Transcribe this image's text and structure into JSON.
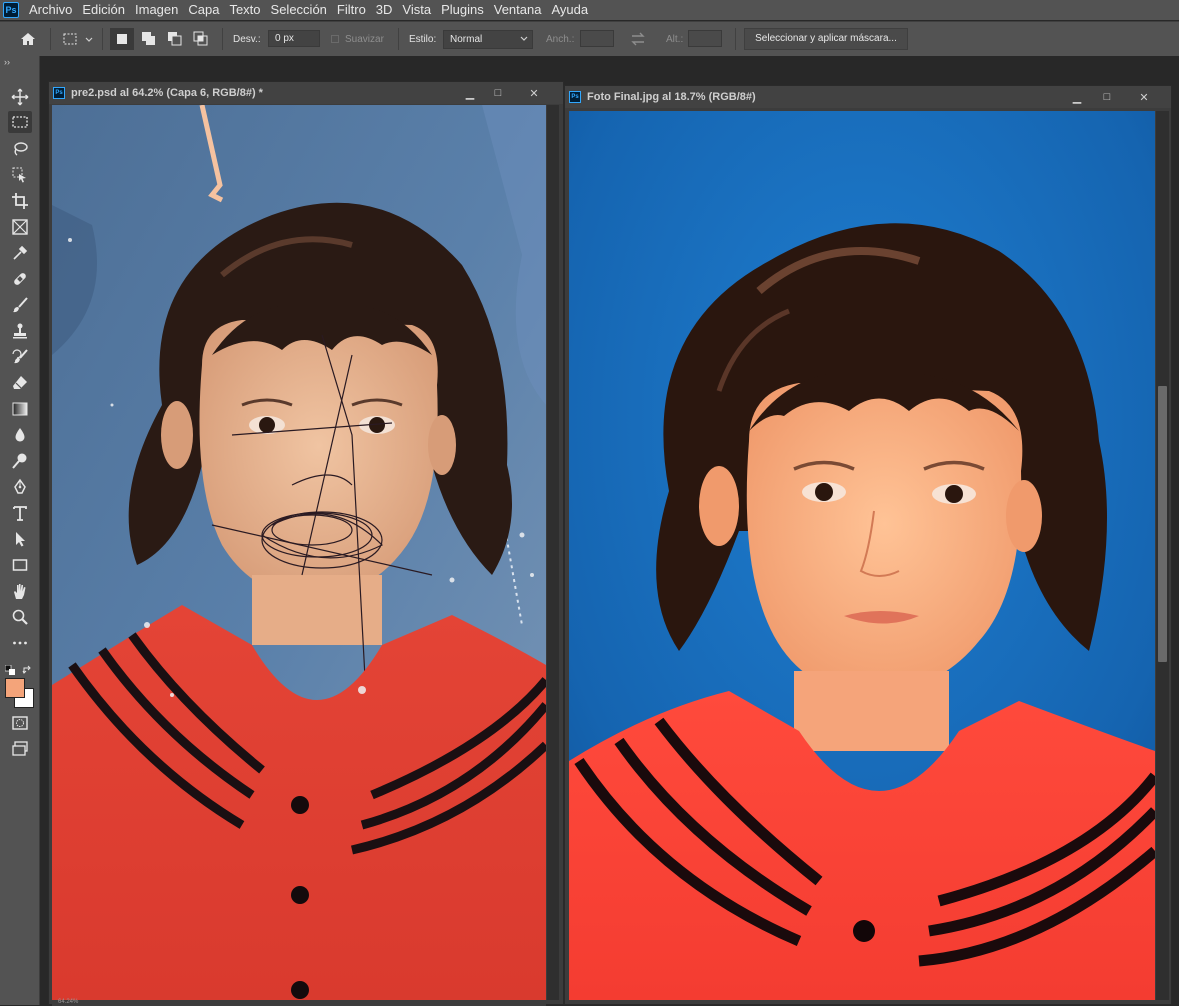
{
  "app": {
    "logo": "Ps"
  },
  "menu": [
    "Archivo",
    "Edición",
    "Imagen",
    "Capa",
    "Texto",
    "Selección",
    "Filtro",
    "3D",
    "Vista",
    "Plugins",
    "Ventana",
    "Ayuda"
  ],
  "options": {
    "feather_label": "Desv.:",
    "feather_value": "0 px",
    "antialias_label": "Suavizar",
    "style_label": "Estilo:",
    "style_value": "Normal",
    "width_label": "Anch.:",
    "height_label": "Alt.:",
    "select_mask_button": "Seleccionar y aplicar máscara..."
  },
  "toolbar": {
    "collapse_glyph": "››",
    "tools": [
      "move-icon",
      "marquee-icon",
      "lasso-icon",
      "object-select-icon",
      "crop-icon",
      "frame-icon",
      "eyedropper-icon",
      "healing-brush-icon",
      "brush-icon",
      "clone-stamp-icon",
      "history-brush-icon",
      "eraser-icon",
      "gradient-icon",
      "blur-icon",
      "dodge-icon",
      "pen-icon",
      "type-icon",
      "path-select-icon",
      "rectangle-icon",
      "hand-icon",
      "zoom-icon",
      "more-tools-icon"
    ],
    "foreground_color": "#f4a47a",
    "background_color": "#ffffff"
  },
  "documents": [
    {
      "title": "pre2.psd al 64.2% (Capa 6, RGB/8#) *",
      "status": "64.24%"
    },
    {
      "title": "Foto Final.jpg al 18.7% (RGB/8#)"
    }
  ],
  "window_controls": {
    "minimize": "▁",
    "maximize": "□",
    "close": "✕"
  }
}
